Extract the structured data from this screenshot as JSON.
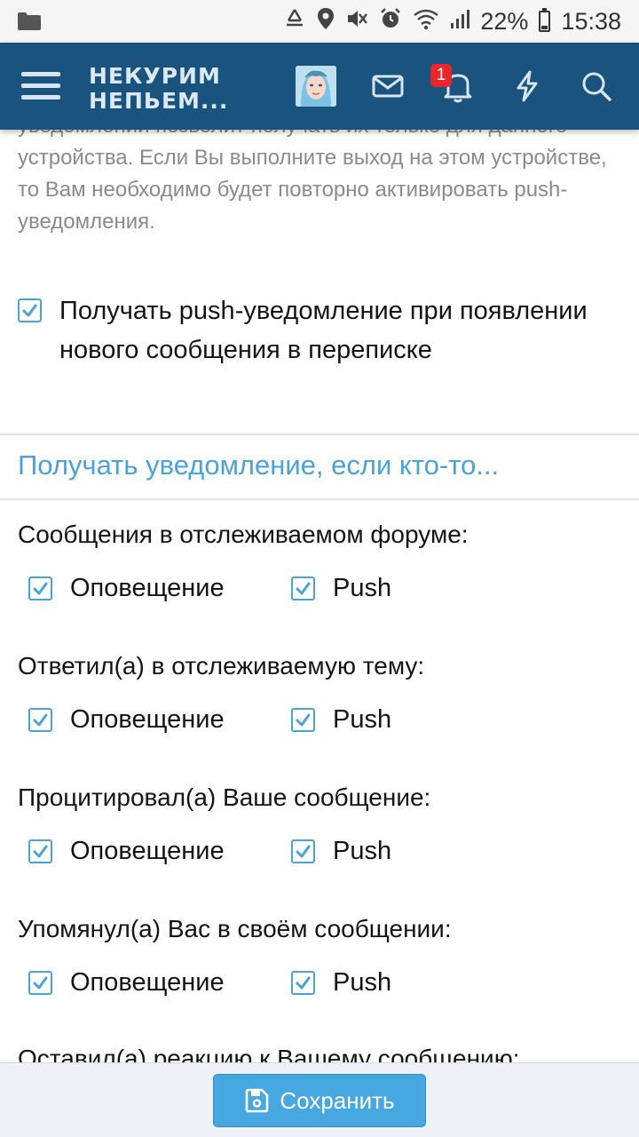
{
  "status_bar": {
    "battery": "22%",
    "time": "15:38",
    "icons": [
      "folder-icon",
      "recycle-icon",
      "location-icon",
      "mute-icon",
      "alarm-icon",
      "wifi-icon",
      "signal-icon",
      "battery-icon"
    ]
  },
  "header": {
    "logo_line1": "НЕКУРИМ",
    "logo_line2": "НЕПЬЕМ...",
    "notification_count": "1",
    "icons": [
      "menu-icon",
      "avatar",
      "mail-icon",
      "bell-icon",
      "lightning-icon",
      "search-icon"
    ],
    "colors": {
      "bar": "#1b537f",
      "badge": "#e8262c"
    }
  },
  "intro_text": "уведомлений позволит получать их только для данного устройства. Если Вы выполните выход на этом устройстве, то Вам необходимо будет повторно активировать push-уведомления.",
  "push_conversation": {
    "label": "Получать push-уведомление при появлении нового сообщения в переписке",
    "checked": true
  },
  "section_title": "Получать уведомление, если кто-то...",
  "groups": [
    {
      "title": "Сообщения в отслеживаемом форуме:",
      "alert_label": "Оповещение",
      "push_label": "Push",
      "alert": true,
      "push": true
    },
    {
      "title": "Ответил(а) в отслеживаемую тему:",
      "alert_label": "Оповещение",
      "push_label": "Push",
      "alert": true,
      "push": true
    },
    {
      "title": "Процитировал(а) Ваше сообщение:",
      "alert_label": "Оповещение",
      "push_label": "Push",
      "alert": true,
      "push": true
    },
    {
      "title": "Упомянул(а) Вас в своём сообщении:",
      "alert_label": "Оповещение",
      "push_label": "Push",
      "alert": true,
      "push": true
    },
    {
      "title": "Оставил(а) реакцию к Вашему сообщению:"
    }
  ],
  "footer": {
    "save_label": "Сохранить"
  },
  "accent_color": "#49a3d7"
}
